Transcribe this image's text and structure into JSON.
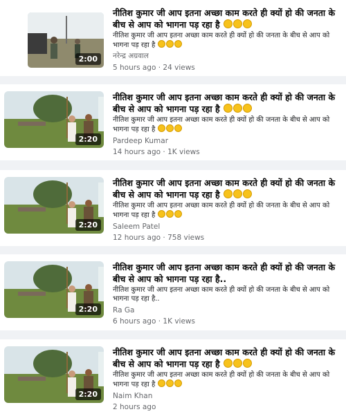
{
  "results": [
    {
      "title": "नीतिश कुमार जी आप इतना अच्छा काम करते ही क्यों हो की जनता के बीच से आप को भागना पड़ रहा है",
      "snippet": "नीतिश कुमार जी आप इतना अच्छा काम करते ही क्यों हो की जनता के बीच से आप को भागना पड़ रहा है",
      "author": "नरेन्द्र अग्रवाल",
      "time": "5 hours ago",
      "views": "24 views",
      "duration": "2:00"
    },
    {
      "title": "नीतिश कुमार जी आप इतना अच्छा काम करते ही क्यों हो की जनता के बीच से आप को भागना पड़ रहा है",
      "snippet": "नीतिश कुमार जी आप इतना अच्छा काम करते ही क्यों हो की जनता के बीच से आप को भागना पड़ रहा है",
      "author": "Pardeep Kumar",
      "time": "14 hours ago",
      "views": "1K views",
      "duration": "2:20"
    },
    {
      "title": "नीतिश कुमार जी आप इतना अच्छा काम करते ही क्यों हो की जनता के बीच से आप को भागना पड़ रहा है",
      "snippet": "नीतिश कुमार जी आप इतना अच्छा काम करते ही क्यों हो की जनता के बीच से आप को भागना पड़ रहा है",
      "author": "Saleem Patel",
      "time": "12 hours ago",
      "views": "758 views",
      "duration": "2:20"
    },
    {
      "title": "नीतिश कुमार जी आप इतना अच्छा काम करते ही क्यों हो की जनता के बीच से आप को भागना पड़ रहा है..",
      "snippet": "नीतिश कुमार जी आप इतना अच्छा काम करते ही क्यों हो की जनता के बीच से आप को भागना पड़ रहा है..",
      "author": "Ra Ga",
      "time": "6 hours ago",
      "views": "1K views",
      "duration": "2:20"
    },
    {
      "title": "नीतिश कुमार जी आप इतना अच्छा काम करते ही क्यों हो की जनता के बीच से आप को भागना पड़ रहा है",
      "snippet": "नीतिश कुमार जी आप इतना अच्छा काम करते ही क्यों हो की जनता के बीच से आप को भागना पड़ रहा है",
      "author": "Naim Khan",
      "time": "2 hours ago",
      "views": "",
      "duration": "2:20"
    }
  ],
  "separator": " · ",
  "emoji_icon": "laughing-face-icon"
}
